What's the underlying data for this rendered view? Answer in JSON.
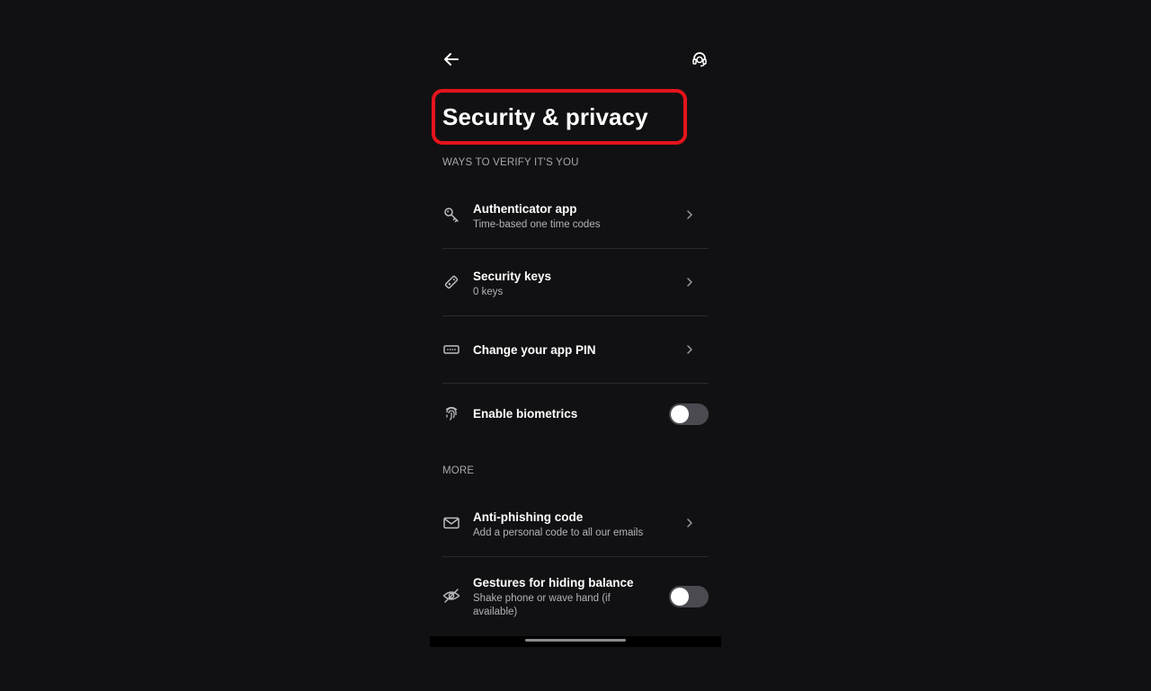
{
  "header": {
    "back_icon": "arrow-left-icon",
    "support_icon": "headset-support-icon"
  },
  "title": "Security & privacy",
  "accent_color": "#e5141c",
  "sections": [
    {
      "label": "WAYS TO VERIFY IT'S YOU",
      "items": [
        {
          "icon": "key-icon",
          "label": "Authenticator app",
          "sub": "Time-based one time codes",
          "control": "chevron"
        },
        {
          "icon": "security-key-icon",
          "label": "Security keys",
          "sub": "0 keys",
          "control": "chevron"
        },
        {
          "icon": "pin-icon",
          "label": "Change your app PIN",
          "sub": "",
          "control": "chevron"
        },
        {
          "icon": "fingerprint-icon",
          "label": "Enable biometrics",
          "sub": "",
          "control": "toggle",
          "toggle_on": false
        }
      ]
    },
    {
      "label": "MORE",
      "items": [
        {
          "icon": "mail-icon",
          "label": "Anti-phishing code",
          "sub": "Add a personal code to all our emails",
          "control": "chevron"
        },
        {
          "icon": "eye-off-icon",
          "label": "Gestures for hiding balance",
          "sub": "Shake phone or wave hand (if available)",
          "control": "toggle",
          "toggle_on": false
        }
      ]
    }
  ]
}
